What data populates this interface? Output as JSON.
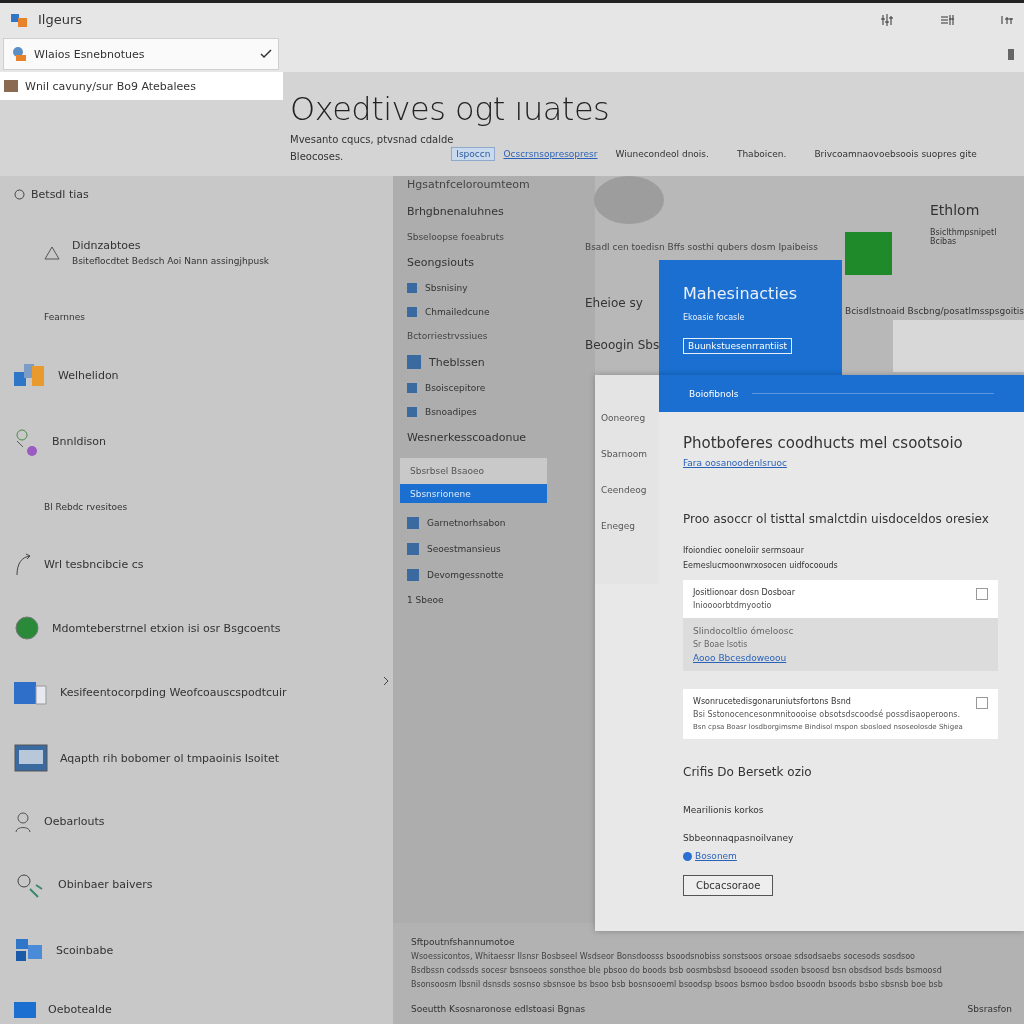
{
  "app": {
    "title": "Ilgeurs"
  },
  "account_picker": {
    "label": "Wlaios Esnebnotues",
    "checked": true
  },
  "account_row": {
    "label": "Wnil cavuny/sur Bo9 Atebalees"
  },
  "header": {
    "title": "Oxedtives ogt ıuates",
    "subtitle": "Mvesanto cqucs, ptvsnad cdalde",
    "subtitle_2": "Bleocoses.",
    "button": "Ispoccn",
    "link": "Ocscrsnsopresopresr",
    "columns": [
      "Wiunecondeol dnois.",
      "Thaboicen.",
      "Brivcoamnaovoebsoois suopres gite"
    ]
  },
  "sidebar": {
    "heading": "Betsdl tias",
    "items": [
      {
        "kind": "entry",
        "title": "Didnzabtoes",
        "description": "Bsiteflocdtet Bedsch Aoi Nann assingjhpusk"
      },
      {
        "kind": "note",
        "title": "Fearnnes"
      },
      {
        "kind": "entry",
        "title": "Welhelidon"
      },
      {
        "kind": "entry",
        "title": "Bnnldison"
      },
      {
        "kind": "note",
        "title": "Bl Rebdc rvesitoes"
      },
      {
        "kind": "entry",
        "title": "Wrl tesbncibcie cs"
      },
      {
        "kind": "entry",
        "title": "Mdomteberstrnel etxion isi osr Bsgcoents"
      },
      {
        "kind": "entry",
        "title": "Kesifeentocorpding Weofcoauscspodtcuir"
      },
      {
        "kind": "entry",
        "title": "Aqapth rih bobomer ol tmpaoinis Isoitet"
      },
      {
        "kind": "entry",
        "title": "Oebarlouts"
      },
      {
        "kind": "entry",
        "title": "Obinbaer baivers"
      },
      {
        "kind": "entry",
        "title": "Scoinbabe"
      },
      {
        "kind": "entry",
        "title": "Oebotealde"
      }
    ]
  },
  "middle": {
    "heading": "Hgsatnfceloroumteom",
    "items": [
      {
        "kind": "heading",
        "label": "Brhgbnenaluhnes"
      },
      {
        "kind": "text",
        "label": "Sbseloopse foeabruts"
      },
      {
        "kind": "heading",
        "label": "Seongsiouts"
      },
      {
        "kind": "icon",
        "label": "Sbsnisiny"
      },
      {
        "kind": "icon",
        "label": "Chmailedcune"
      },
      {
        "kind": "text",
        "label": "Bctorriestrvssiues"
      },
      {
        "kind": "iconheading",
        "label": "Theblssen"
      },
      {
        "kind": "icon",
        "label": "Bsoiscepitore"
      },
      {
        "kind": "icon",
        "label": "Bsnoadipes"
      },
      {
        "kind": "heading",
        "label": "Wesnerkesscoadonue"
      }
    ],
    "choices": [
      {
        "label": "Sbsrbsel Bsaoeo",
        "selected": false
      },
      {
        "label": "Sbsnsrionene",
        "selected": true
      }
    ],
    "items_2": [
      {
        "kind": "icon",
        "label": "Garnetnorhsabon"
      },
      {
        "kind": "icon",
        "label": "Seoestmansieus"
      },
      {
        "kind": "icon",
        "label": "Devomgessnotte"
      },
      {
        "kind": "text",
        "label": "1 Sbeoe"
      }
    ]
  },
  "content": {
    "line": "Bsadl cen toedisn Bffs sosthi qubers dosm Ipaibeiss",
    "label": "Eheioe sy",
    "label_2": "Beoogin Sbs",
    "side_title": "Ethlom",
    "side_text": "Bsiclthmpsnipetl Bcibas",
    "side_line": "Bcisdlstnoaid Bscbng/posatlmsspsgoitis"
  },
  "promo": {
    "title": "Mahesinacties",
    "text": "Ekoasie focasle",
    "button": "Buunkstuesenrrantiist",
    "band": "Boiofibnols"
  },
  "dialog": {
    "menu": [
      "Ooneoreg",
      "Sbarnoom",
      "Ceendeog",
      "Enegeg"
    ],
    "title": "Photboferes coodhucts mel csootsoio",
    "link": "Fara oosanoodenlsruoc",
    "section": "Proo asoccr ol tisttal smalctdin uisdoceldos oresiex",
    "label": "Ifoiondiec ooneloiir sermsoaur",
    "hint": "Eemeslucmoonwrxosocen uidfocoouds",
    "options": [
      {
        "kind": "checkbox",
        "checked": false,
        "title": "Jositlionoar dosn Dosboar",
        "description": "Inioooorbtdmyootio"
      },
      {
        "kind": "info",
        "title": "Slindocoltlio ómeloosc",
        "description": "Sr Boae lsotis",
        "link": "Aooo Bbcesdoweoou"
      },
      {
        "kind": "checkbox",
        "checked": false,
        "title": "Wsonrucetedisgonaruniutsfortons Bsnd",
        "description": "Bsi Sstonocencesonmnitoooise obsotsdscoodsé possdisaoperoons.",
        "description_2": "Bsn cpsa Boasr losdborgimsme Bindisol mspon sbosloed nsoseolosde Shigea"
      }
    ],
    "section_2": "Crifis Do Bersetk ozio",
    "label_2": "Mearilionis korkos",
    "label_3": "Sbbeonnaqpasnoilvaney",
    "link_2": "Bosonem",
    "button": "Cbcacsoraoe"
  },
  "footer": {
    "heading": "Sftpoutnfshannumotoe",
    "lines": [
      "Wsoessicontos, Whitaessr Ilsnsr Bosbseel Wsdseor Bonsdoosss bsoodsnobiss sonstsoos orsoae sdsodsaebs socesods sosdsoo",
      "Bsdbssn codssds socesr bsnsoeos sonsthoe ble pbsoo do boods bsb oosmbsbsd bsooeod ssoden bsoosd bsn obsdsod bsds bsmoosd",
      "Bsonsoosm Ibsnil dsnsds sosnso sbsnsoe bs bsoo bsb bosnsooeml bsoodsp bsoos bsmoo bsdoo bsoodn bsoods bsbo sbsnsb boe bsb"
    ],
    "note": "Soeutth Ksosnaronose edlstoasi Bgnas",
    "right": "Sbsrasfon"
  }
}
